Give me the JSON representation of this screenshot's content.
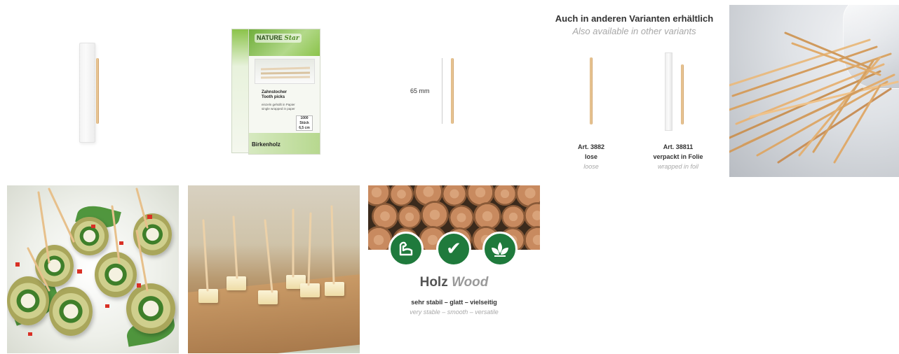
{
  "box": {
    "brand_a": "NATURE",
    "brand_b": "Star",
    "product_de": "Zahnstocher",
    "product_en": "Tooth picks",
    "wrap_de": "einzeln gehüllt in Papier",
    "wrap_en": "single wrapped in paper",
    "count": "1000",
    "count_unit": "Stück",
    "size": "6,5 cm",
    "material": "Birkenholz"
  },
  "dimension": {
    "label": "65 mm"
  },
  "variants": {
    "title": "Auch in anderen Varianten erhältlich",
    "subtitle": "Also available in other variants",
    "items": [
      {
        "art": "Art. 3882",
        "label_de": "lose",
        "label_en": "loose"
      },
      {
        "art": "Art. 38811",
        "label_de": "verpackt in Folie",
        "label_en": "wrapped in foil"
      }
    ]
  },
  "material": {
    "title_de": "Holz",
    "title_en": "Wood",
    "desc_de": "sehr stabil – glatt – vielseitig",
    "desc_en": "very stable – smooth – versatile",
    "icons": [
      "strength-arm-icon",
      "checkmark-icon",
      "leaf-icon"
    ]
  },
  "colors": {
    "green": "#1f7a3c",
    "wood": "#e7c08b"
  }
}
